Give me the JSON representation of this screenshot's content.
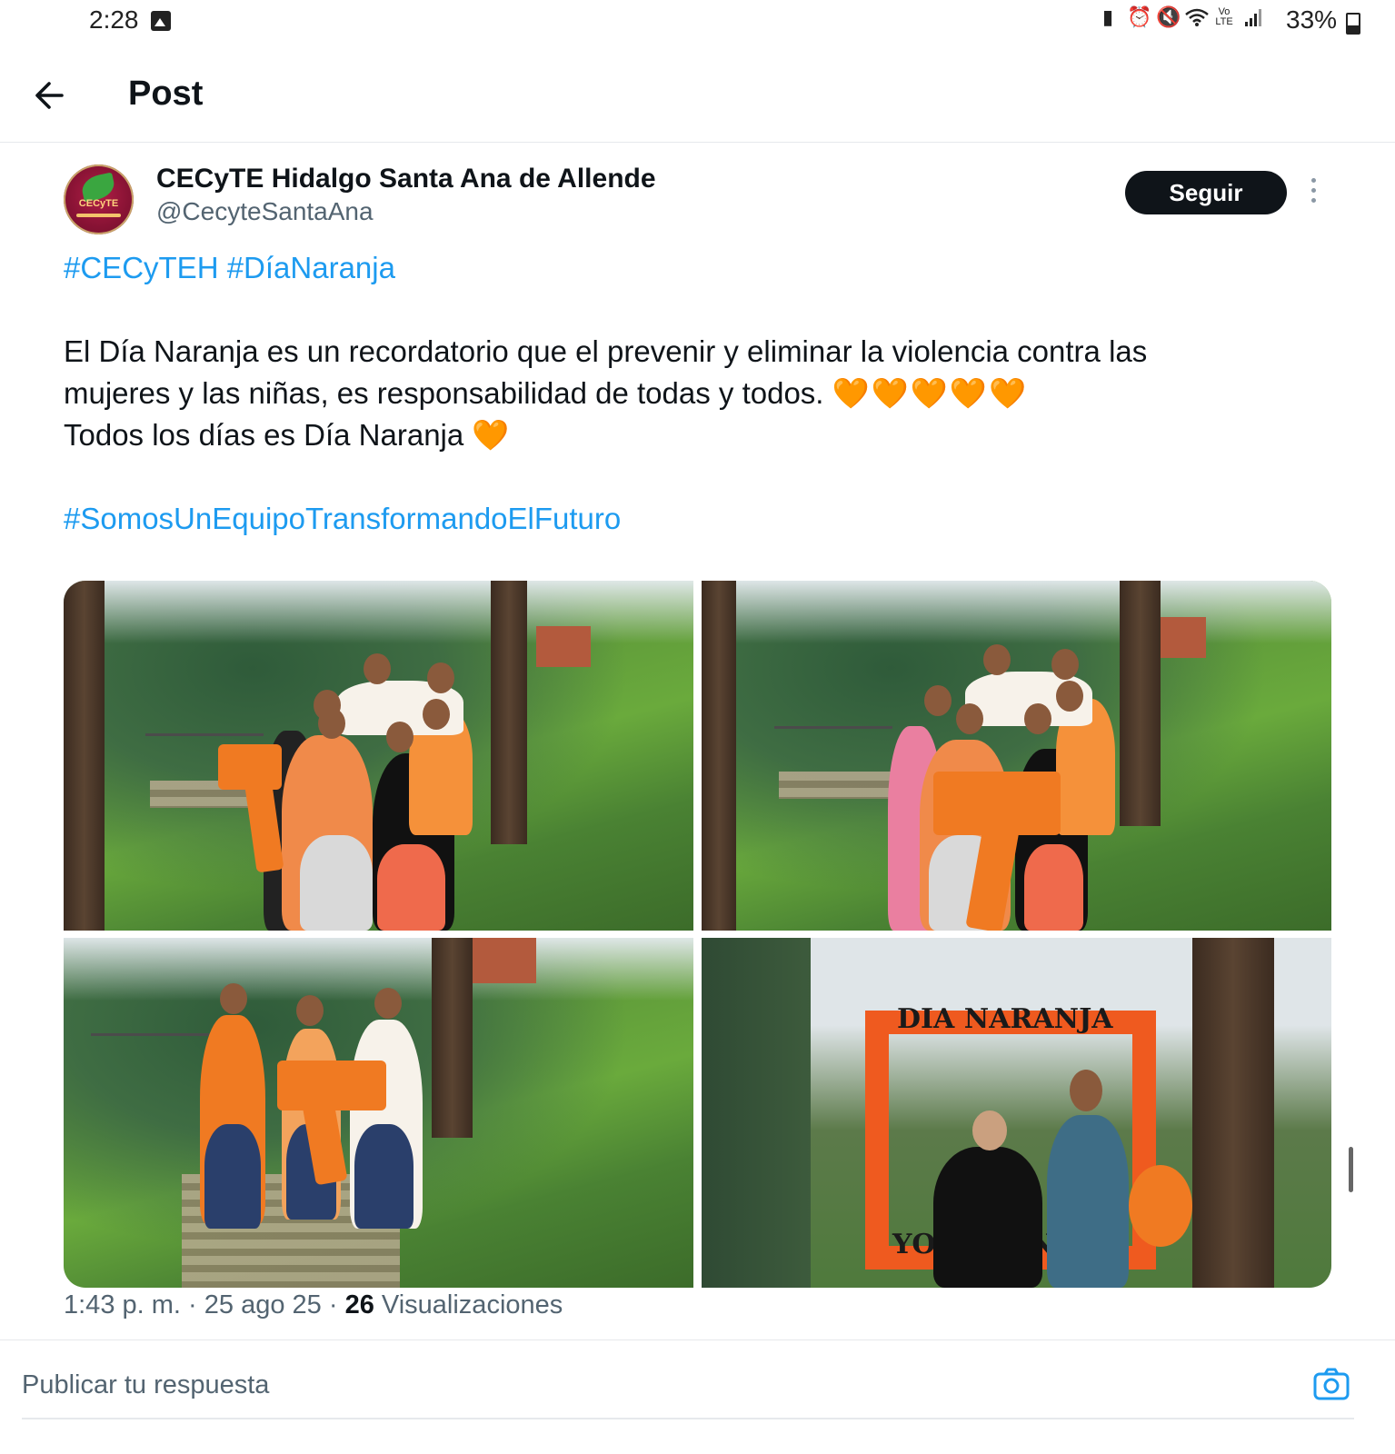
{
  "status_bar": {
    "time": "2:28",
    "battery": "33%",
    "icons": [
      "gallery-icon",
      "battery-saver-icon",
      "alarm-icon",
      "mute-icon",
      "wifi-icon",
      "volte-icon",
      "signal-icon"
    ]
  },
  "header": {
    "back_icon": "arrow-left-icon",
    "title": "Post"
  },
  "tweet": {
    "author_name": "CECyTE Hidalgo Santa Ana de Allende",
    "author_handle": "@CecyteSantaAna",
    "follow_label": "Seguir",
    "hashtags_line": [
      "#CECyTEH",
      "#DíaNaranja"
    ],
    "body_line1": "El Día Naranja es un recordatorio que el prevenir y eliminar la violencia contra las",
    "body_line2": "mujeres y las niñas, es responsabilidad de todas y todos.",
    "body_line2_emoji": "🧡🧡🧡🧡🧡",
    "body_line3": "Todos los días es Día Naranja",
    "body_line3_emoji": "🧡",
    "closing_hashtag": "#SomosUnEquipoTransformandoElFuturo",
    "photo4_sign_top": "DIA NARANJA",
    "photo4_sign_bottom": "YO ME UNO",
    "meta": {
      "time": "1:43 p. m.",
      "date": "25 ago 25",
      "views_count": "26",
      "views_label": "Visualizaciones",
      "separator": "·"
    }
  },
  "reply": {
    "placeholder": "Publicar tu respuesta",
    "camera_icon": "camera-icon"
  },
  "colors": {
    "hashtag": "#1d9bf0",
    "follow_bg": "#0f1419",
    "secondary_text": "#536471",
    "orange": "#f07a22"
  }
}
